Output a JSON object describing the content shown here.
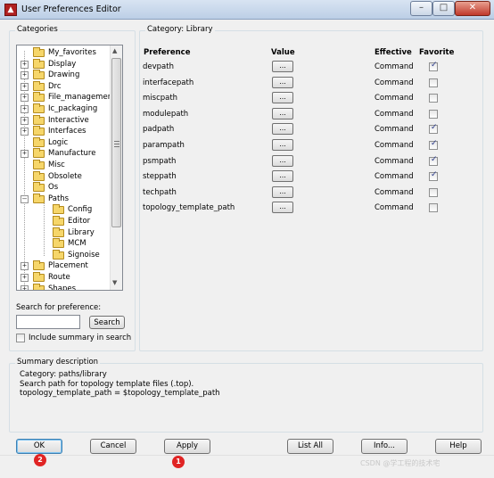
{
  "window": {
    "title": "User Preferences Editor",
    "minimize": "–",
    "maximize": "□",
    "close": "✕"
  },
  "categories": {
    "label": "Categories",
    "items": [
      {
        "label": "My_favorites",
        "expander": "",
        "indent": 0
      },
      {
        "label": "Display",
        "expander": "+",
        "indent": 0
      },
      {
        "label": "Drawing",
        "expander": "+",
        "indent": 0
      },
      {
        "label": "Drc",
        "expander": "+",
        "indent": 0
      },
      {
        "label": "File_management",
        "expander": "+",
        "indent": 0
      },
      {
        "label": "Ic_packaging",
        "expander": "+",
        "indent": 0
      },
      {
        "label": "Interactive",
        "expander": "+",
        "indent": 0
      },
      {
        "label": "Interfaces",
        "expander": "+",
        "indent": 0
      },
      {
        "label": "Logic",
        "expander": "",
        "indent": 0
      },
      {
        "label": "Manufacture",
        "expander": "+",
        "indent": 0
      },
      {
        "label": "Misc",
        "expander": "",
        "indent": 0
      },
      {
        "label": "Obsolete",
        "expander": "",
        "indent": 0
      },
      {
        "label": "Os",
        "expander": "",
        "indent": 0
      },
      {
        "label": "Paths",
        "expander": "–",
        "indent": 0
      },
      {
        "label": "Config",
        "expander": "",
        "indent": 1
      },
      {
        "label": "Editor",
        "expander": "",
        "indent": 1
      },
      {
        "label": "Library",
        "expander": "",
        "indent": 1,
        "selected": true
      },
      {
        "label": "MCM",
        "expander": "",
        "indent": 1
      },
      {
        "label": "Signoise",
        "expander": "",
        "indent": 1
      },
      {
        "label": "Placement",
        "expander": "+",
        "indent": 0
      },
      {
        "label": "Route",
        "expander": "+",
        "indent": 0
      },
      {
        "label": "Shapes",
        "expander": "+",
        "indent": 0
      }
    ]
  },
  "search": {
    "label": "Search for preference:",
    "value": "",
    "button": "Search",
    "include_summary_label": "Include summary in search",
    "include_summary_checked": false
  },
  "category": {
    "prefix": "Category:",
    "name": "Library"
  },
  "table": {
    "headers": {
      "preference": "Preference",
      "value": "Value",
      "effective": "Effective",
      "favorite": "Favorite"
    },
    "rows": [
      {
        "name": "devpath",
        "value_btn": "...",
        "effective": "Command",
        "favorite": true
      },
      {
        "name": "interfacepath",
        "value_btn": "...",
        "effective": "Command",
        "favorite": false
      },
      {
        "name": "miscpath",
        "value_btn": "...",
        "effective": "Command",
        "favorite": false
      },
      {
        "name": "modulepath",
        "value_btn": "...",
        "effective": "Command",
        "favorite": false
      },
      {
        "name": "padpath",
        "value_btn": "...",
        "effective": "Command",
        "favorite": true
      },
      {
        "name": "parampath",
        "value_btn": "...",
        "effective": "Command",
        "favorite": true
      },
      {
        "name": "psmpath",
        "value_btn": "...",
        "effective": "Command",
        "favorite": true
      },
      {
        "name": "steppath",
        "value_btn": "...",
        "effective": "Command",
        "favorite": true
      },
      {
        "name": "techpath",
        "value_btn": "...",
        "effective": "Command",
        "favorite": false
      },
      {
        "name": "topology_template_path",
        "value_btn": "...",
        "effective": "Command",
        "favorite": false
      }
    ]
  },
  "summary": {
    "label": "Summary description",
    "lines": [
      "Category: paths/library",
      "Search path for topology template files (.top).",
      "topology_template_path = $topology_template_path"
    ]
  },
  "buttons": {
    "ok": "OK",
    "cancel": "Cancel",
    "apply": "Apply",
    "list_all": "List All",
    "info": "Info...",
    "help": "Help"
  },
  "annotations": {
    "badge_ok": "2",
    "badge_apply": "1",
    "badge_color": "#e02424"
  },
  "watermark": "CSDN @学工程的技术宅"
}
